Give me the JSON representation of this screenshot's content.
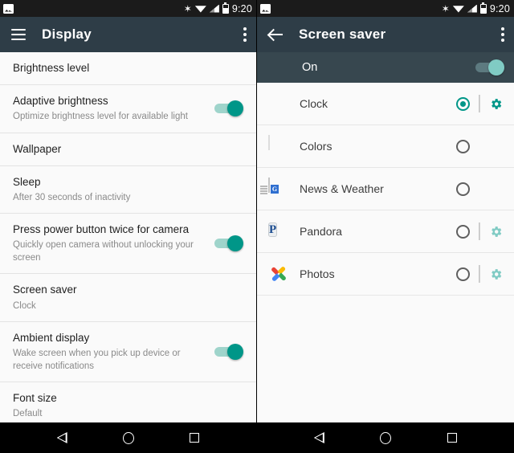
{
  "status_bar": {
    "notification_icon": "photo-icon",
    "icons": [
      "bluetooth-icon",
      "wifi-icon",
      "signal-icon",
      "battery-icon"
    ],
    "time": "9:20"
  },
  "left_panel": {
    "header": {
      "menu_icon": "hamburger-icon",
      "title": "Display",
      "overflow_icon": "more-vert-icon"
    },
    "rows": [
      {
        "title": "Brightness level",
        "sub": "",
        "toggle": null
      },
      {
        "title": "Adaptive brightness",
        "sub": "Optimize brightness level for available light",
        "toggle": "on"
      },
      {
        "title": "Wallpaper",
        "sub": "",
        "toggle": null
      },
      {
        "title": "Sleep",
        "sub": "After 30 seconds of inactivity",
        "toggle": null
      },
      {
        "title": "Press power button twice for camera",
        "sub": "Quickly open camera without unlocking your screen",
        "toggle": "on"
      },
      {
        "title": "Screen saver",
        "sub": "Clock",
        "toggle": null
      },
      {
        "title": "Ambient display",
        "sub": "Wake screen when you pick up device or receive notifications",
        "toggle": "on"
      },
      {
        "title": "Font size",
        "sub": "Default",
        "toggle": null
      }
    ]
  },
  "right_panel": {
    "header": {
      "back_icon": "back-arrow-icon",
      "title": "Screen saver",
      "overflow_icon": "more-vert-icon"
    },
    "master_toggle": {
      "label": "On",
      "state": "on"
    },
    "items": [
      {
        "name": "Clock",
        "icon": "clock-app-icon",
        "selected": true,
        "has_settings": true,
        "settings_enabled": true
      },
      {
        "name": "Colors",
        "icon": "colors-app-icon",
        "selected": false,
        "has_settings": false,
        "settings_enabled": false
      },
      {
        "name": "News & Weather",
        "icon": "news-weather-app-icon",
        "selected": false,
        "has_settings": false,
        "settings_enabled": false
      },
      {
        "name": "Pandora",
        "icon": "pandora-app-icon",
        "selected": false,
        "has_settings": true,
        "settings_enabled": false
      },
      {
        "name": "Photos",
        "icon": "photos-app-icon",
        "selected": false,
        "has_settings": true,
        "settings_enabled": false
      }
    ]
  },
  "nav_bar": {
    "back": "back-nav-icon",
    "home": "home-nav-icon",
    "recents": "recents-nav-icon"
  },
  "colors": {
    "accent_teal": "#009688",
    "accent_teal_light": "#80cbc4",
    "action_bar": "#2e3d47",
    "on_bar": "#37474f",
    "background": "#fafafa"
  }
}
